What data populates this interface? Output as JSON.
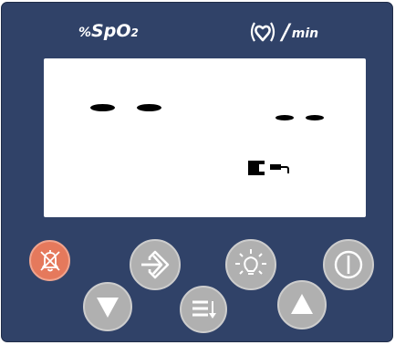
{
  "labels": {
    "spo2_prefix": "%",
    "spo2_main": "SpO",
    "spo2_sub": "2",
    "pulse_slash": "/",
    "pulse_unit": "min"
  },
  "display": {
    "spo2_value": "- -",
    "pulse_value": "- -",
    "status_icon": "sensor-plug-icon"
  },
  "buttons": [
    {
      "name": "alarm-silence-button",
      "icon": "crossed-bell-icon"
    },
    {
      "name": "down-button",
      "icon": "down-triangle-icon"
    },
    {
      "name": "enter-button",
      "icon": "enter-arrow-icon"
    },
    {
      "name": "menu-button",
      "icon": "menu-list-icon"
    },
    {
      "name": "brightness-button",
      "icon": "sun-icon"
    },
    {
      "name": "up-button",
      "icon": "up-triangle-icon"
    },
    {
      "name": "power-button",
      "icon": "power-icon"
    }
  ],
  "colors": {
    "panel": "#304268",
    "lcd": "#ffffff",
    "button": "#b0b0b0",
    "alarm_button": "#e5795c"
  }
}
